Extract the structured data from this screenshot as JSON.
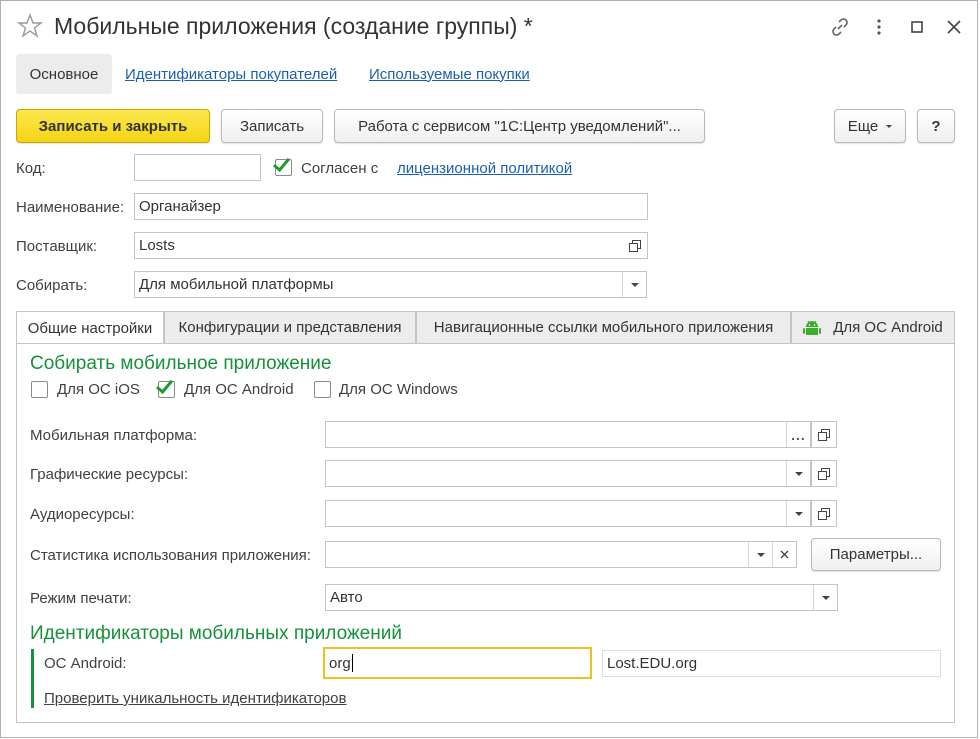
{
  "window": {
    "title": "Мобильные приложения (создание группы) *"
  },
  "nav_tabs": [
    {
      "label": "Основное"
    },
    {
      "label": "Идентификаторы покупателей"
    },
    {
      "label": "Используемые покупки"
    }
  ],
  "toolbar": {
    "save_close": "Записать и закрыть",
    "save": "Записать",
    "service": "Работа с сервисом \"1С:Центр уведомлений\"...",
    "more": "Еще",
    "help": "?"
  },
  "form": {
    "code_label": "Код:",
    "code_value": "",
    "agree_label": "Согласен с",
    "agree_checked": true,
    "agree_link": "лицензионной политикой",
    "name_label": "Наименование:",
    "name_value": "Органайзер",
    "supplier_label": "Поставщик:",
    "supplier_value": "Losts",
    "build_label": "Собирать:",
    "build_value": "Для мобильной платформы"
  },
  "panel_tabs": [
    {
      "label": "Общие настройки"
    },
    {
      "label": "Конфигурации и представления"
    },
    {
      "label": "Навигационные ссылки мобильного приложения"
    },
    {
      "label": "Для ОС Android"
    }
  ],
  "general": {
    "section1_title": "Собирать мобильное приложение",
    "os_ios": "Для ОС iOS",
    "os_android": "Для ОС Android",
    "os_windows": "Для ОС Windows",
    "platform_label": "Мобильная платформа:",
    "platform_value": "",
    "platform_btn": "...",
    "graphics_label": "Графические ресурсы:",
    "graphics_value": "",
    "audio_label": "Аудиоресурсы:",
    "audio_value": "",
    "stats_label": "Статистика использования приложения:",
    "stats_value": "",
    "params_button": "Параметры...",
    "print_label": "Режим печати:",
    "print_value": "Авто",
    "section2_title": "Идентификаторы мобильных приложений",
    "android_label": "ОС Android:",
    "android_id_input": "org",
    "android_id_full": "Lost.EDU.org",
    "check_link": "Проверить уникальность идентификаторов"
  },
  "colors": {
    "accent_green": "#15913b",
    "link_blue": "#1a5fb0",
    "primary_yellow": "#f5d415",
    "focus_orange": "#f0c020"
  }
}
